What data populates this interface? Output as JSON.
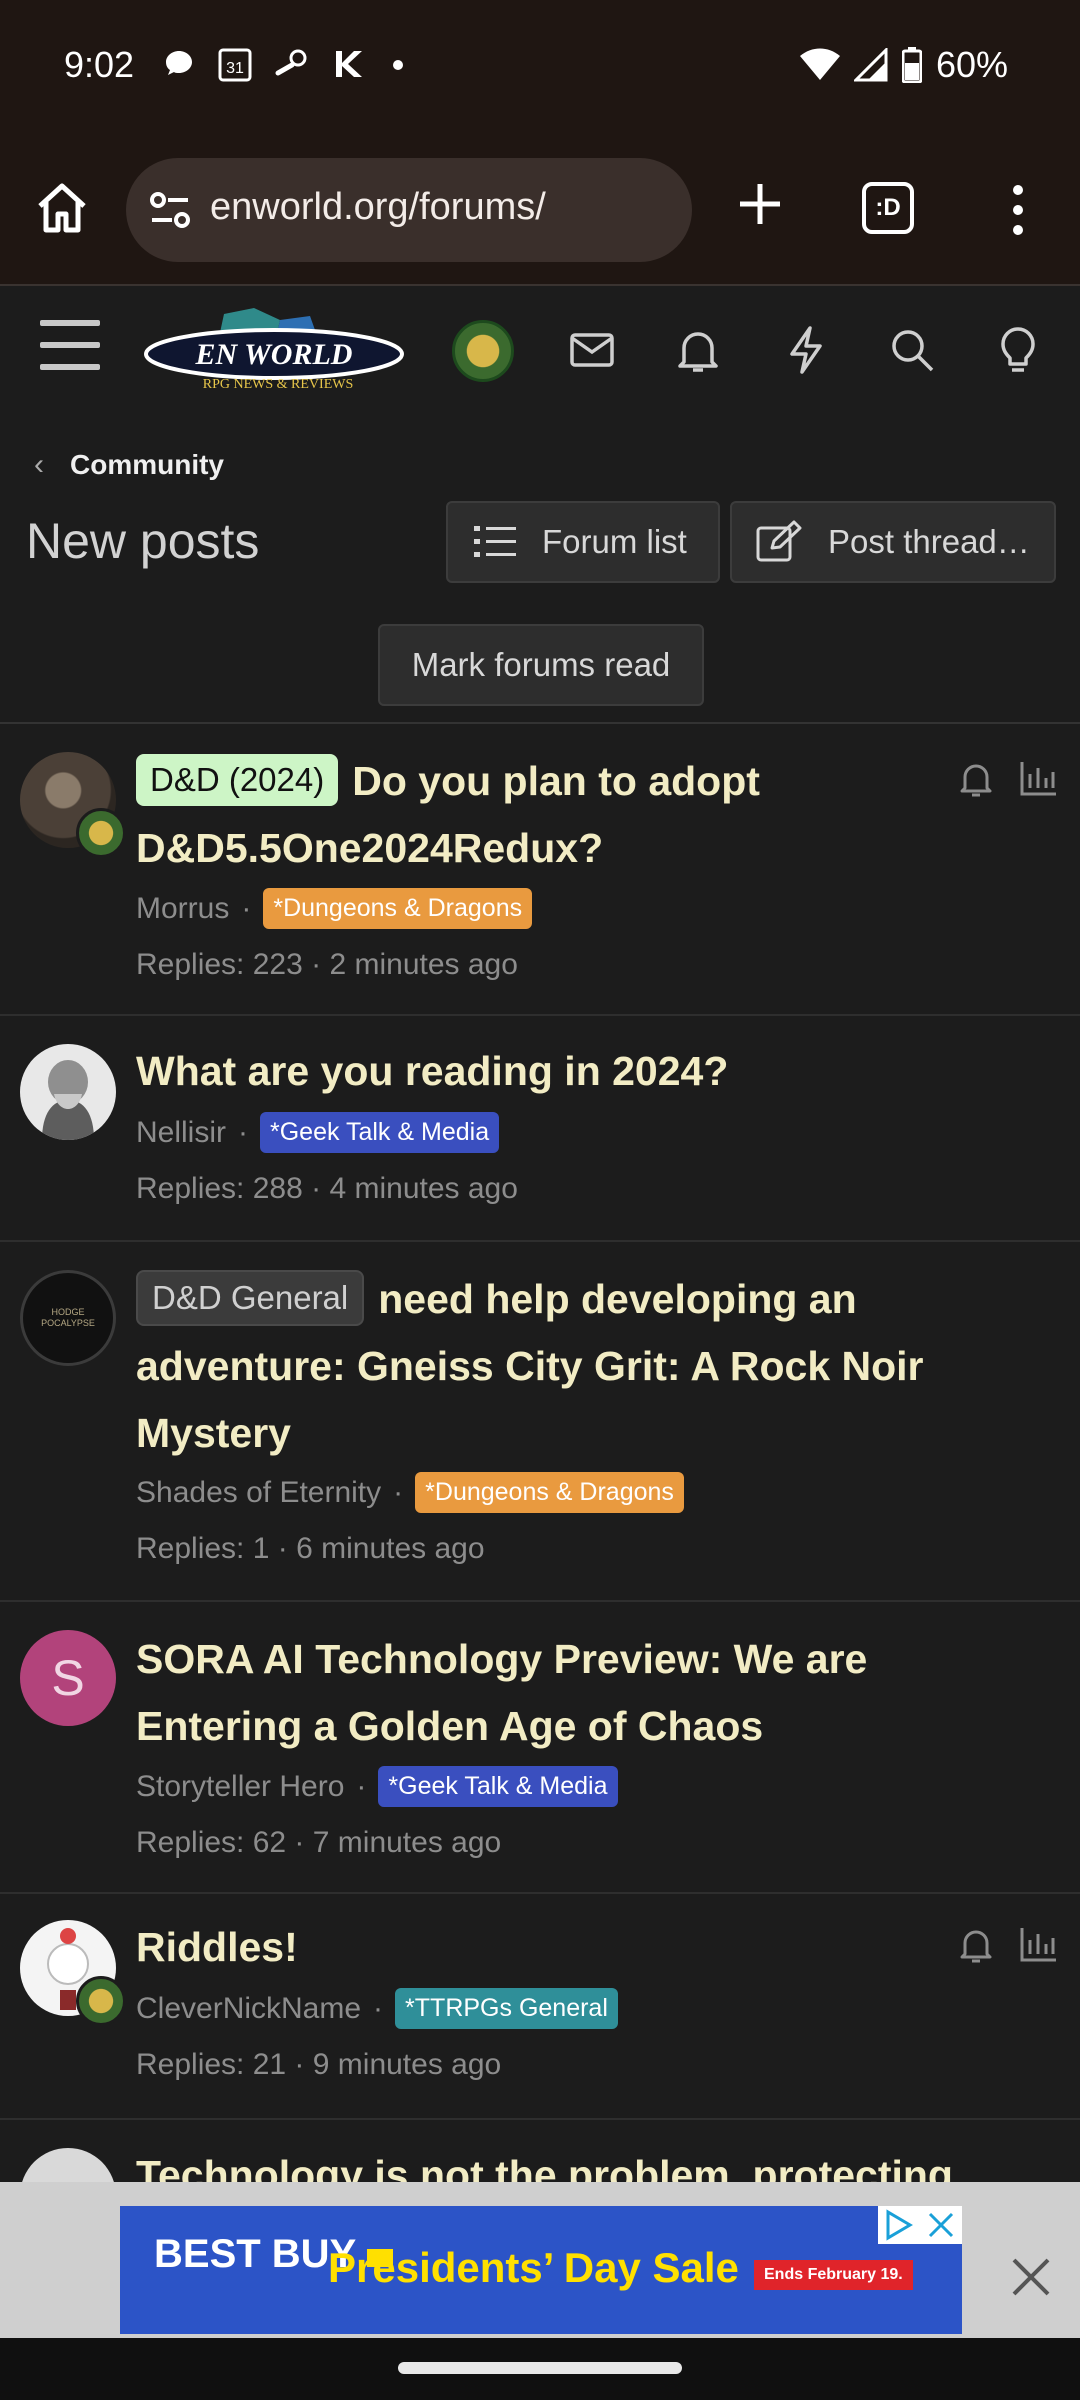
{
  "status": {
    "time": "9:02",
    "battery": "60%",
    "calendar_day": "31",
    "icons_left": [
      "chat-bubble-icon",
      "calendar-icon",
      "steam-icon",
      "kotlin-icon",
      "dot-icon"
    ],
    "icons_right": [
      "wifi-icon",
      "signal-icon",
      "battery-icon"
    ]
  },
  "browser": {
    "url": "enworld.org/forums/",
    "tabs_label": ":D"
  },
  "breadcrumb": {
    "label": "Community"
  },
  "page": {
    "title": "New posts",
    "forum_list_label": "Forum list",
    "post_thread_label": "Post thread…",
    "mark_read_label": "Mark forums read"
  },
  "threads": [
    {
      "prefix": "D&D (2024)",
      "title": "Do you plan to adopt D&D5.5One2024Redux?",
      "author": "Morrus",
      "forum": "*Dungeons & Dragons",
      "replies": "Replies: 223",
      "time": "2 minutes ago"
    },
    {
      "prefix": "",
      "title": "What are you reading in 2024?",
      "author": "Nellisir",
      "forum": "*Geek Talk & Media",
      "replies": "Replies: 288",
      "time": "4 minutes ago"
    },
    {
      "prefix": "D&D General",
      "title": "need help developing an adventure: Gneiss City Grit: A Rock Noir Mystery",
      "author": "Shades of Eternity",
      "forum": "*Dungeons & Dragons",
      "replies": "Replies: 1",
      "time": "6 minutes ago",
      "avatar_text": "HODGE POCALYPSE"
    },
    {
      "prefix": "",
      "title": "SORA AI Technology Preview: We are Entering a Golden Age of Chaos",
      "author": "Storyteller Hero",
      "forum": "*Geek Talk & Media",
      "replies": "Replies: 62",
      "time": "7 minutes ago",
      "avatar_letter": "S"
    },
    {
      "prefix": "",
      "title": "Riddles!",
      "author": "CleverNickName",
      "forum": "*TTRPGs General",
      "replies": "Replies: 21",
      "time": "9 minutes ago"
    },
    {
      "prefix": "",
      "title": "Technology is not the problem, protecting"
    }
  ],
  "ad": {
    "brand": "BEST BUY",
    "headline": "Presidents’ Day Sale",
    "badge": "Ends February 19."
  },
  "colors": {
    "accent_title": "#f2ecc4",
    "tag_orange": "#e99a3f",
    "tag_blue": "#3a4fbf",
    "tag_teal": "#2f8f99",
    "prefix_green": "#cdf5c6"
  }
}
